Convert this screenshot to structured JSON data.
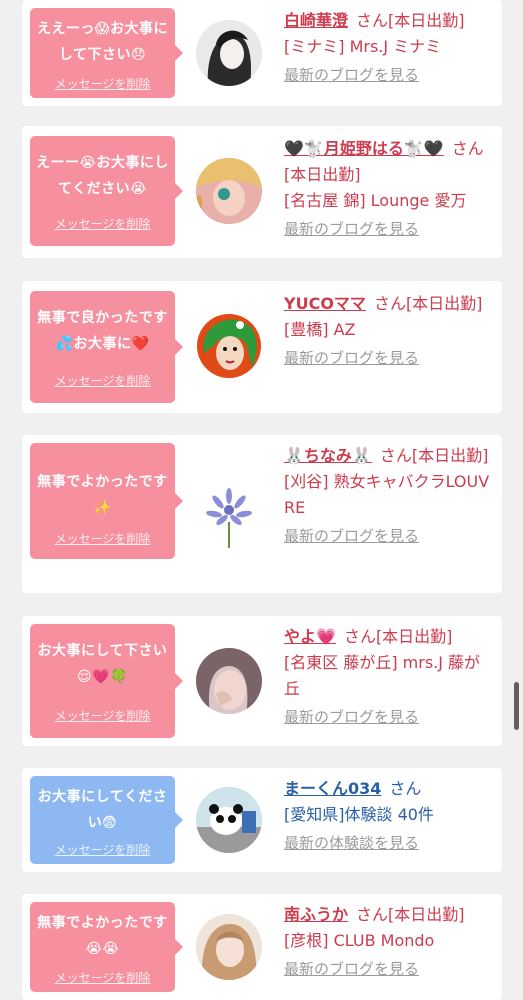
{
  "delete_label": "メッセージを削除",
  "colors": {
    "bubble_pink": "#f6909f",
    "bubble_blue": "#8db8f2",
    "name_pink": "#cc3c4e",
    "name_blue": "#2a5fa8"
  },
  "entries": [
    {
      "message": "ええーっ😱お大事にして下さい😞",
      "name": "白崎華澄",
      "suffix": "さん[本日出勤]",
      "detail": "[ミナミ] Mrs.J ミナミ",
      "link": "最新のブログを見る"
    },
    {
      "message": "えーー😭お大事にしてください😭",
      "name": "🖤🐩月姫野はる🐩🖤",
      "suffix": "さん[本日出勤]",
      "detail": "[名古屋 錦] Lounge 愛万",
      "link": "最新のブログを見る"
    },
    {
      "message": "無事で良かったです💦お大事に❤️",
      "name": "YUCOママ",
      "suffix": "さん[本日出勤]",
      "detail": "[豊橋] AZ",
      "link": "最新のブログを見る"
    },
    {
      "message": "無事でよかったです✨",
      "name": "🐰ちなみ🐰",
      "suffix": "さん[本日出勤]",
      "detail": "[刈谷] 熟女キャバクラLOUVRE",
      "link": "最新のブログを見る"
    },
    {
      "message": "お大事にして下さい😌💗🍀",
      "name": "やよ💗",
      "suffix": "さん[本日出勤]",
      "detail": "[名東区 藤が丘] mrs.J 藤が丘",
      "link": "最新のブログを見る"
    },
    {
      "message": "お大事にしてください😨",
      "name": "まーくん034",
      "suffix": "さん",
      "detail": "[愛知県]体験談 40件",
      "link": "最新の体験談を見る"
    },
    {
      "message": "無事でよかったです😭😭",
      "name": "南ふうか",
      "suffix": "さん[本日出勤]",
      "detail": "[彦根] CLUB Mondo",
      "link": "最新のブログを見る"
    }
  ]
}
